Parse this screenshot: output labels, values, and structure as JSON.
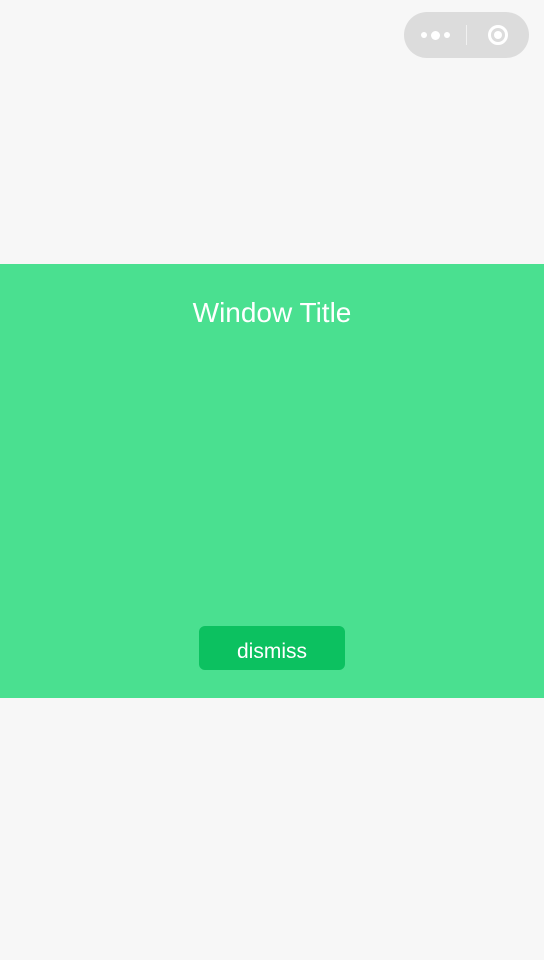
{
  "capsule": {
    "more_icon": "more-dots-icon",
    "close_icon": "close-target-icon"
  },
  "window": {
    "title": "Window Title",
    "dismiss_label": "dismiss",
    "background_color": "#4ae090",
    "button_color": "#0cc160"
  },
  "colors": {
    "page_background": "#f7f7f7",
    "text": "#ffffff"
  }
}
